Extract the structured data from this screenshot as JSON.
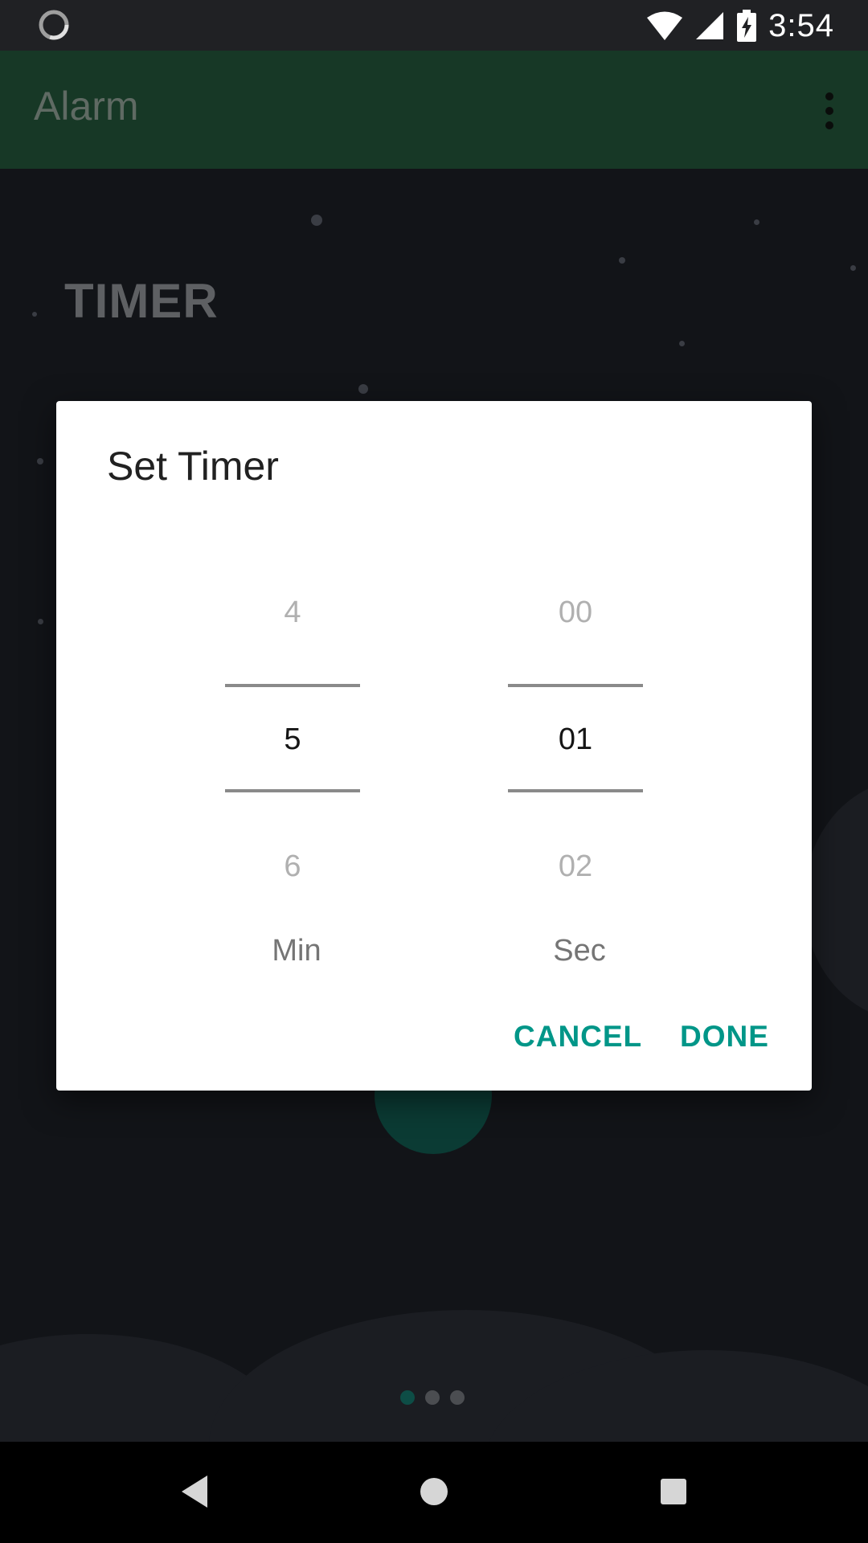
{
  "status_bar": {
    "time": "3:54",
    "icons": [
      "loading-icon",
      "wifi-icon",
      "signal-icon",
      "battery-charging-icon"
    ]
  },
  "app_bar": {
    "title": "Alarm",
    "menu_icon": "more-vert-icon"
  },
  "background": {
    "section_title": "TIMER",
    "page_indicator": {
      "count": 3,
      "active_index": 0
    }
  },
  "dialog": {
    "title": "Set Timer",
    "minutes": {
      "prev": "4",
      "current": "5",
      "next": "6",
      "unit": "Min"
    },
    "seconds": {
      "prev": "00",
      "current": "01",
      "next": "02",
      "unit": "Sec"
    },
    "cancel_label": "CANCEL",
    "done_label": "DONE"
  },
  "nav_bar": {
    "icons": [
      "back-icon",
      "home-icon",
      "recents-icon"
    ]
  },
  "colors": {
    "accent": "#009688",
    "app_bar": "#173826",
    "background": "#121418"
  }
}
